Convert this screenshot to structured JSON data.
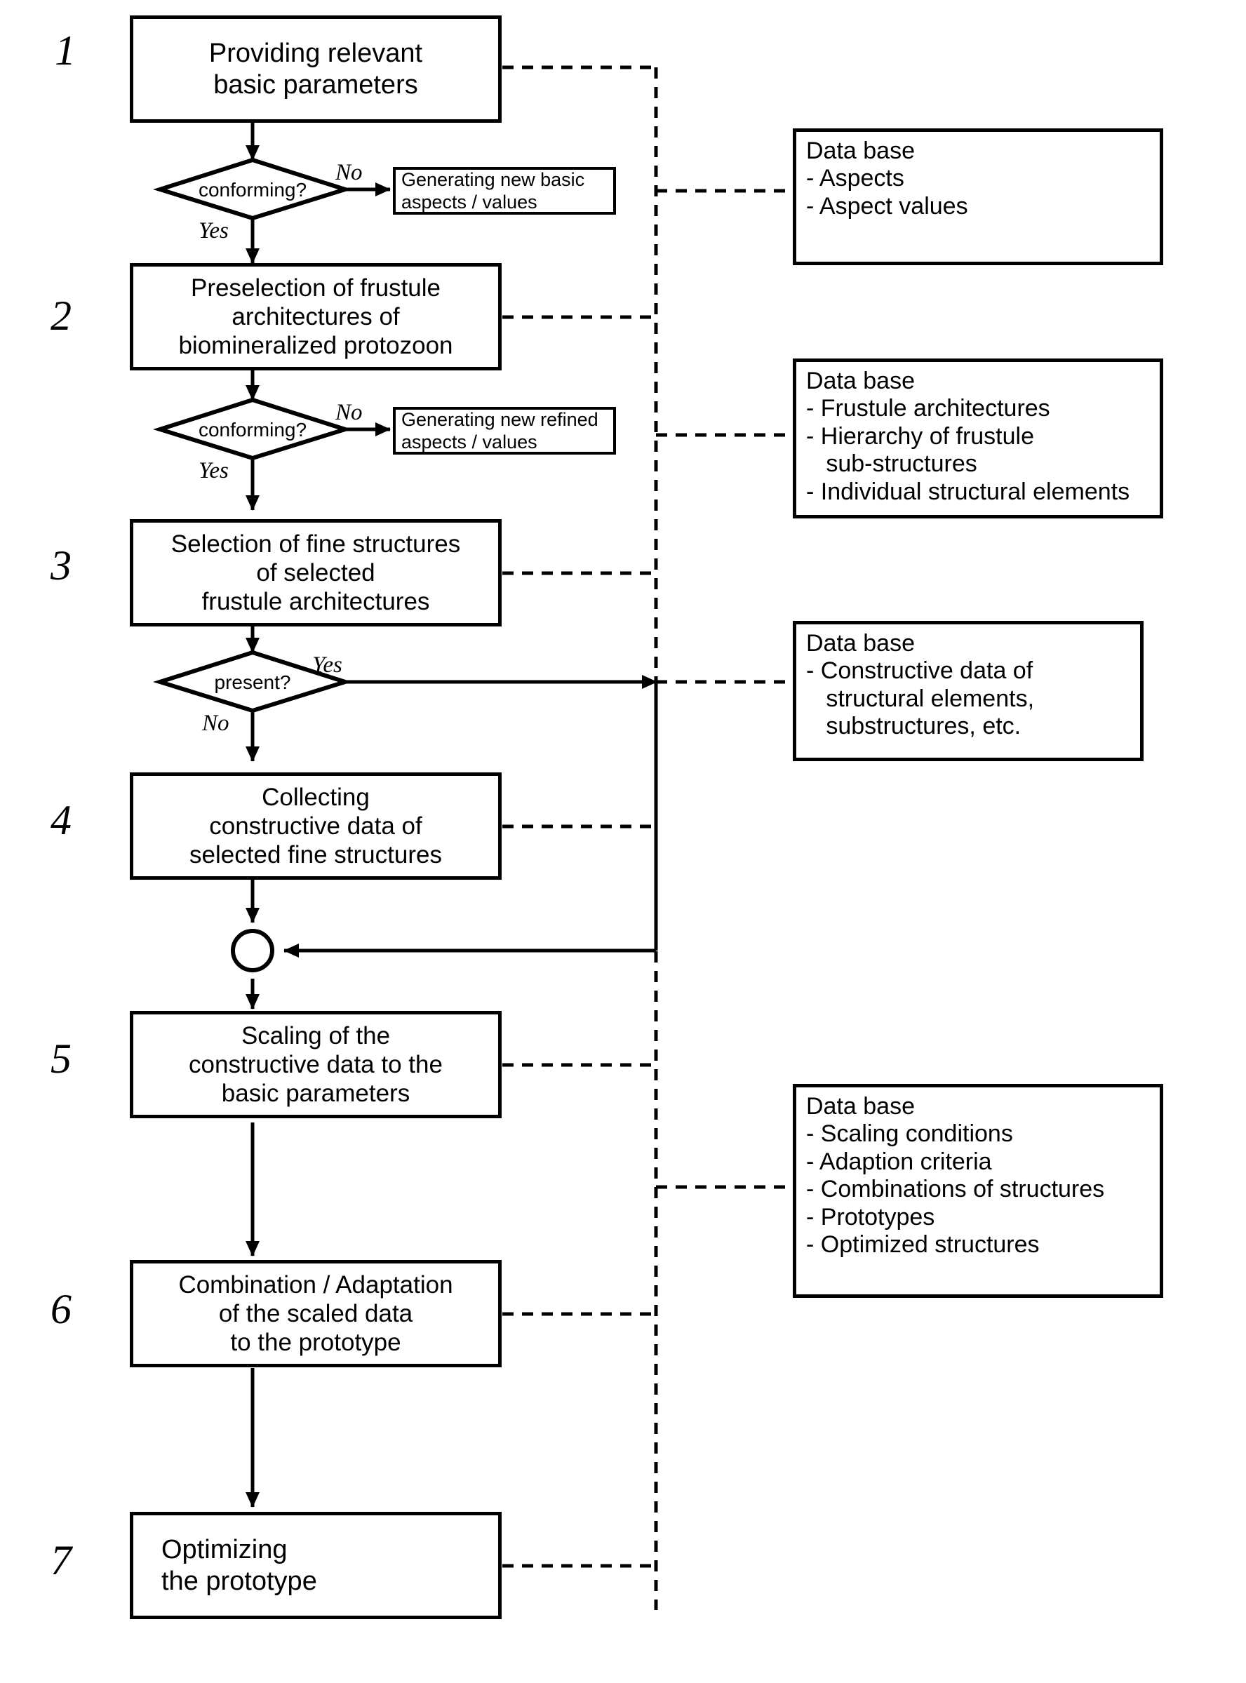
{
  "diagram": {
    "type": "flowchart",
    "title": "",
    "steps": [
      {
        "number": "1",
        "name": "providing-basic-parameters",
        "lines": [
          "Providing relevant",
          "basic parameters"
        ]
      },
      {
        "number": "2",
        "name": "preselection-frustule-architectures",
        "lines": [
          "Preselection of frustule",
          "architectures of",
          "biomineralized protozoon"
        ]
      },
      {
        "number": "3",
        "name": "selection-fine-structures",
        "lines": [
          "Selection of fine structures",
          "of selected",
          "frustule architectures"
        ]
      },
      {
        "number": "4",
        "name": "collecting-constructive-data",
        "lines": [
          "Collecting",
          "constructive data of",
          "selected fine structures"
        ]
      },
      {
        "number": "5",
        "name": "scaling-constructive-data",
        "lines": [
          "Scaling of the",
          "constructive data to the",
          "basic parameters"
        ]
      },
      {
        "number": "6",
        "name": "combination-adaptation",
        "lines": [
          "Combination / Adaptation",
          "of the scaled data",
          "to the prototype"
        ]
      },
      {
        "number": "7",
        "name": "optimizing-prototype",
        "lines": [
          "Optimizing",
          "the prototype"
        ]
      }
    ],
    "decisions": [
      {
        "name": "conforming-1",
        "label": "conforming?",
        "branch_no": "No",
        "branch_yes": "Yes"
      },
      {
        "name": "conforming-2",
        "label": "conforming?",
        "branch_no": "No",
        "branch_yes": "Yes"
      },
      {
        "name": "present",
        "label": "present?",
        "branch_no": "No",
        "branch_yes": "Yes"
      }
    ],
    "generators": [
      {
        "name": "generating-new-basic-aspects",
        "lines": [
          "Generating new basic",
          "aspects / values"
        ]
      },
      {
        "name": "generating-new-refined-aspects",
        "lines": [
          "Generating new refined",
          "aspects / values"
        ]
      }
    ],
    "databases": [
      {
        "name": "database-aspects",
        "title": "Data base",
        "items": [
          "- Aspects",
          "- Aspect values"
        ]
      },
      {
        "name": "database-frustule",
        "title": "Data base",
        "items": [
          "- Frustule architectures",
          "- Hierarchy of frustule",
          "   sub-structures",
          "- Individual structural elements"
        ]
      },
      {
        "name": "database-constructive",
        "title": "Data base",
        "items": [
          "- Constructive data of",
          "   structural elements,",
          "   substructures, etc."
        ]
      },
      {
        "name": "database-scaling",
        "title": "Data base",
        "items": [
          "- Scaling conditions",
          "- Adaption criteria",
          "- Combinations of structures",
          "- Prototypes",
          "- Optimized structures"
        ]
      }
    ],
    "connector_node": {
      "name": "merge-circle",
      "label": ""
    },
    "colors": {
      "stroke": "#000000",
      "background": "#ffffff"
    }
  }
}
